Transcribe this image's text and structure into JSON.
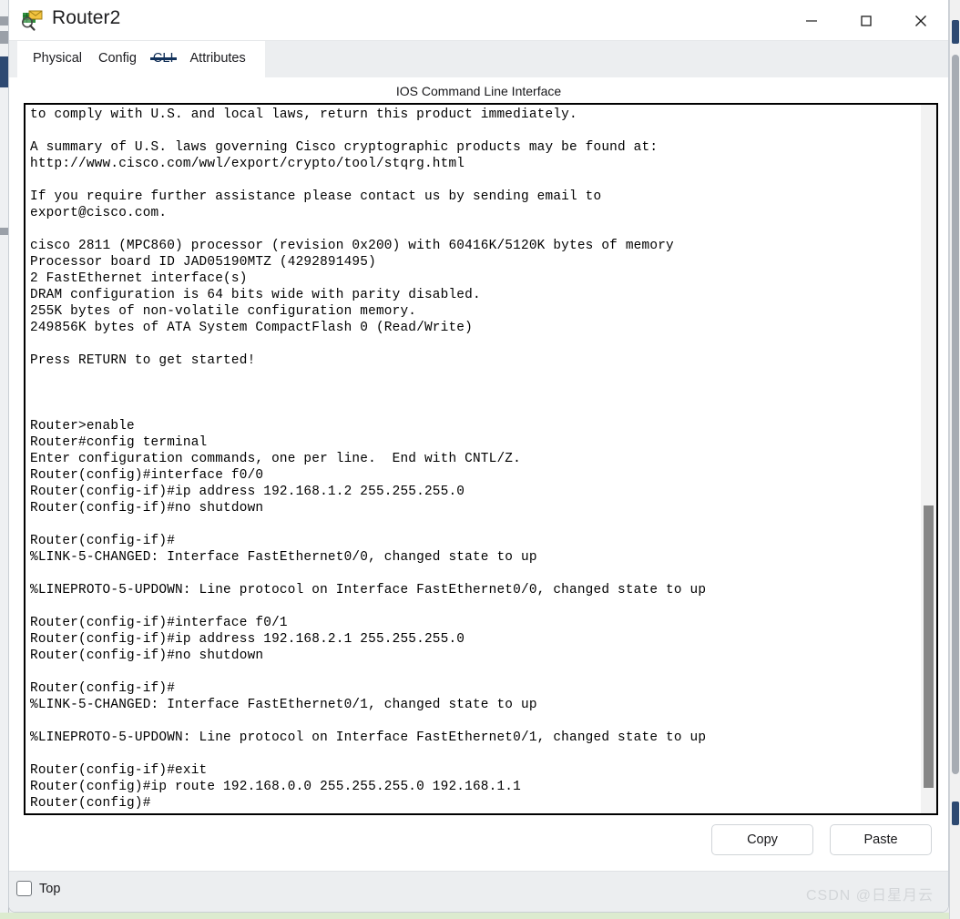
{
  "window": {
    "title": "Router2",
    "icon": "packet-tracer-icon",
    "controls": {
      "minimize": "minimize-icon",
      "maximize": "maximize-icon",
      "close": "close-icon"
    }
  },
  "tabs": [
    {
      "label": "Physical",
      "active": false
    },
    {
      "label": "Config",
      "active": false
    },
    {
      "label": "CLI",
      "active": true
    },
    {
      "label": "Attributes",
      "active": false
    }
  ],
  "main": {
    "heading": "IOS Command Line Interface",
    "terminal_text": "to comply with U.S. and local laws, return this product immediately.\n\nA summary of U.S. laws governing Cisco cryptographic products may be found at:\nhttp://www.cisco.com/wwl/export/crypto/tool/stqrg.html\n\nIf you require further assistance please contact us by sending email to\nexport@cisco.com.\n\ncisco 2811 (MPC860) processor (revision 0x200) with 60416K/5120K bytes of memory\nProcessor board ID JAD05190MTZ (4292891495)\n2 FastEthernet interface(s)\nDRAM configuration is 64 bits wide with parity disabled.\n255K bytes of non-volatile configuration memory.\n249856K bytes of ATA System CompactFlash 0 (Read/Write)\n\nPress RETURN to get started!\n\n\n\nRouter>enable\nRouter#config terminal\nEnter configuration commands, one per line.  End with CNTL/Z.\nRouter(config)#interface f0/0\nRouter(config-if)#ip address 192.168.1.2 255.255.255.0\nRouter(config-if)#no shutdown\n\nRouter(config-if)#\n%LINK-5-CHANGED: Interface FastEthernet0/0, changed state to up\n\n%LINEPROTO-5-UPDOWN: Line protocol on Interface FastEthernet0/0, changed state to up\n\nRouter(config-if)#interface f0/1\nRouter(config-if)#ip address 192.168.2.1 255.255.255.0\nRouter(config-if)#no shutdown\n\nRouter(config-if)#\n%LINK-5-CHANGED: Interface FastEthernet0/1, changed state to up\n\n%LINEPROTO-5-UPDOWN: Line protocol on Interface FastEthernet0/1, changed state to up\n\nRouter(config-if)#exit\nRouter(config)#ip route 192.168.0.0 255.255.255.0 192.168.1.1\nRouter(config)#"
  },
  "actions": {
    "copy_label": "Copy",
    "paste_label": "Paste"
  },
  "footer": {
    "top_checkbox_label": "Top",
    "top_checkbox_checked": false,
    "watermark": "CSDN @日星月云"
  },
  "colors": {
    "accent": "#12325c",
    "window_bg": "#ffffff",
    "chrome_bg": "#eceef0",
    "terminal_fg": "#000000",
    "terminal_bg": "#ffffff",
    "scroll_thumb": "#868686"
  }
}
